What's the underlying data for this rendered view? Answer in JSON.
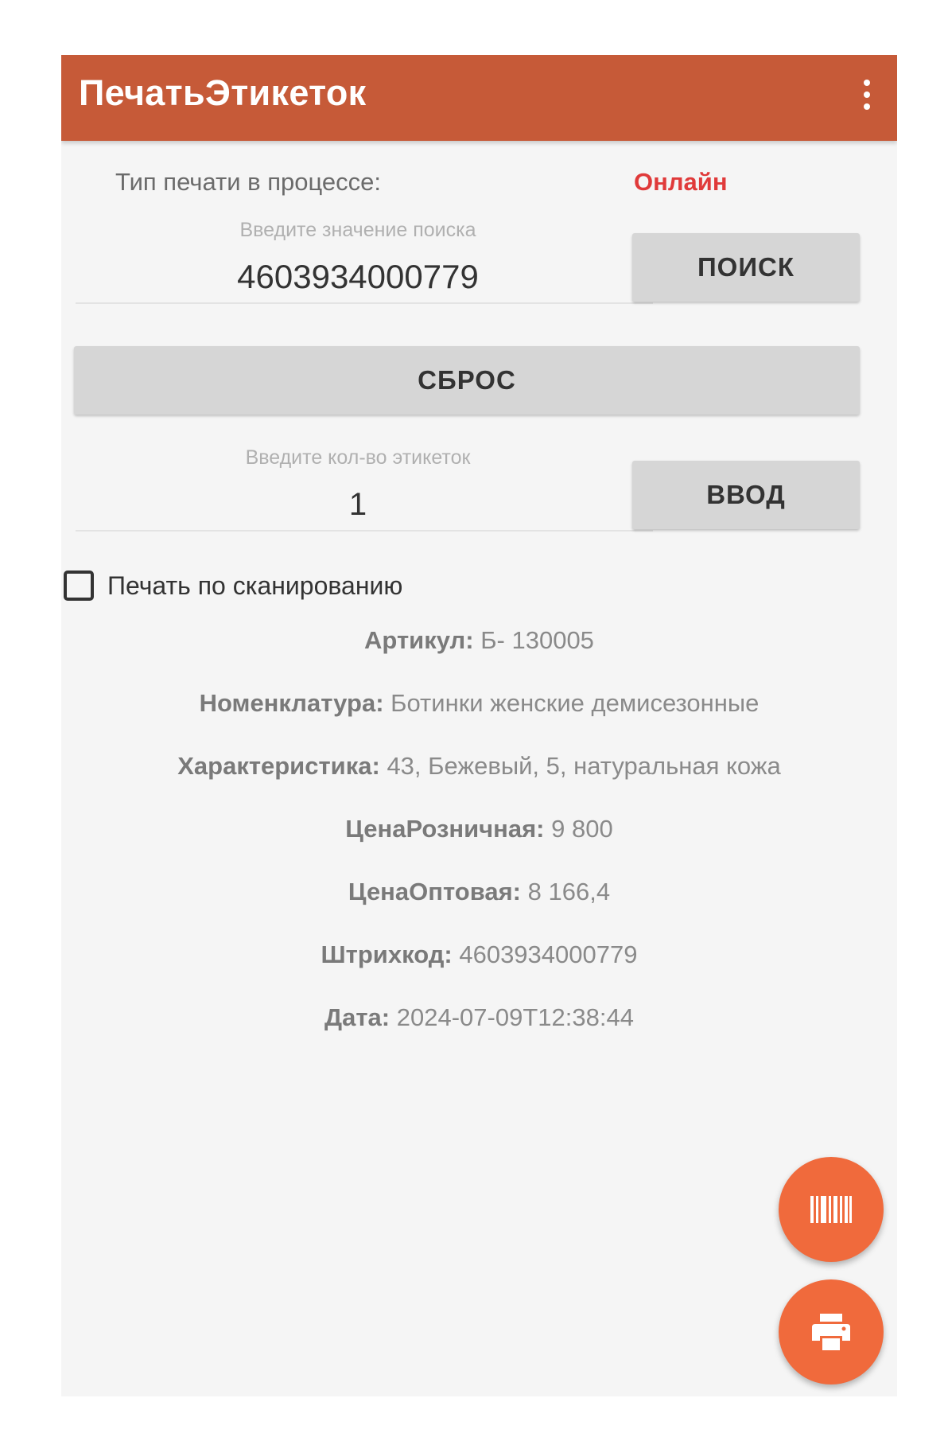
{
  "appbar": {
    "title": "ПечатьЭтикеток",
    "menu_icon": "more-vert-icon"
  },
  "print_type": {
    "label": "Тип печати в процессе:",
    "value": "Онлайн",
    "value_color": "#e03a3a"
  },
  "search": {
    "hint": "Введите значение поиска",
    "value": "4603934000779",
    "button_label": "ПОИСК"
  },
  "reset": {
    "button_label": "СБРОС"
  },
  "quantity": {
    "hint": "Введите кол-во этикеток",
    "value": "1",
    "button_label": "ВВОД"
  },
  "scan_print": {
    "label": "Печать по сканированию",
    "checked": false
  },
  "details": [
    {
      "key": "Артикул:",
      "value": "Б- 130005"
    },
    {
      "key": "Номенклатура:",
      "value": "Ботинки женские демисезонные"
    },
    {
      "key": "Характеристика:",
      "value": "43, Бежевый, 5, натуральная кожа"
    },
    {
      "key": "ЦенаРозничная:",
      "value": "9 800"
    },
    {
      "key": "ЦенаОптовая:",
      "value": "8 166,4"
    },
    {
      "key": "Штрихкод:",
      "value": "4603934000779"
    },
    {
      "key": "Дата:",
      "value": "2024-07-09T12:38:44"
    }
  ],
  "fabs": {
    "scan_icon": "barcode-icon",
    "print_icon": "print-icon",
    "color": "#f06a3c"
  },
  "colors": {
    "appbar": "#c65a38",
    "background": "#f5f5f5"
  }
}
